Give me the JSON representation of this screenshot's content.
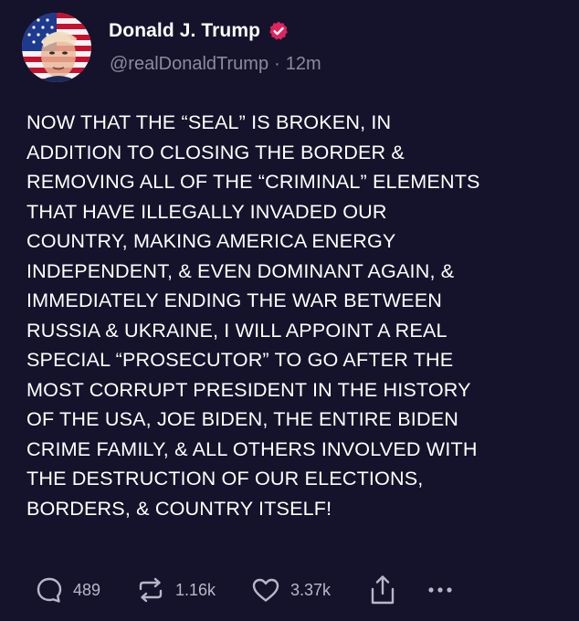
{
  "author": {
    "display_name": "Donald J. Trump",
    "handle": "@realDonaldTrump",
    "separator": "·",
    "time_ago": "12m",
    "avatar_icon": "flag-face-avatar",
    "verified_icon": "verified-badge-icon",
    "verified_color": "#e0245e"
  },
  "post": {
    "lines": [
      "NOW THAT THE “SEAL” IS BROKEN, IN",
      "ADDITION TO CLOSING THE BORDER &",
      "REMOVING ALL OF THE “CRIMINAL” ELEMENTS",
      "THAT HAVE ILLEGALLY INVADED OUR",
      "COUNTRY, MAKING AMERICA ENERGY",
      "INDEPENDENT, & EVEN DOMINANT AGAIN, &",
      "IMMEDIATELY ENDING THE WAR BETWEEN",
      "RUSSIA & UKRAINE, I WILL APPOINT A REAL",
      "SPECIAL “PROSECUTOR” TO GO AFTER THE",
      "MOST CORRUPT PRESIDENT IN THE HISTORY",
      "OF THE USA, JOE BIDEN, THE ENTIRE BIDEN",
      "CRIME FAMILY, & ALL OTHERS INVOLVED WITH",
      "THE DESTRUCTION OF OUR ELECTIONS,",
      "BORDERS, & COUNTRY ITSELF!"
    ]
  },
  "actions": {
    "replies": {
      "icon": "reply-icon",
      "count": "489"
    },
    "reposts": {
      "icon": "repost-icon",
      "count": "1.16k"
    },
    "likes": {
      "icon": "heart-icon",
      "count": "3.37k"
    },
    "share": {
      "icon": "share-icon"
    },
    "more": {
      "icon": "more-icon"
    }
  },
  "colors": {
    "background": "#15132b",
    "text": "#ffffff",
    "secondary_text": "#8b8a9e",
    "action_icon": "#b8b7c9",
    "verified": "#e0245e"
  }
}
